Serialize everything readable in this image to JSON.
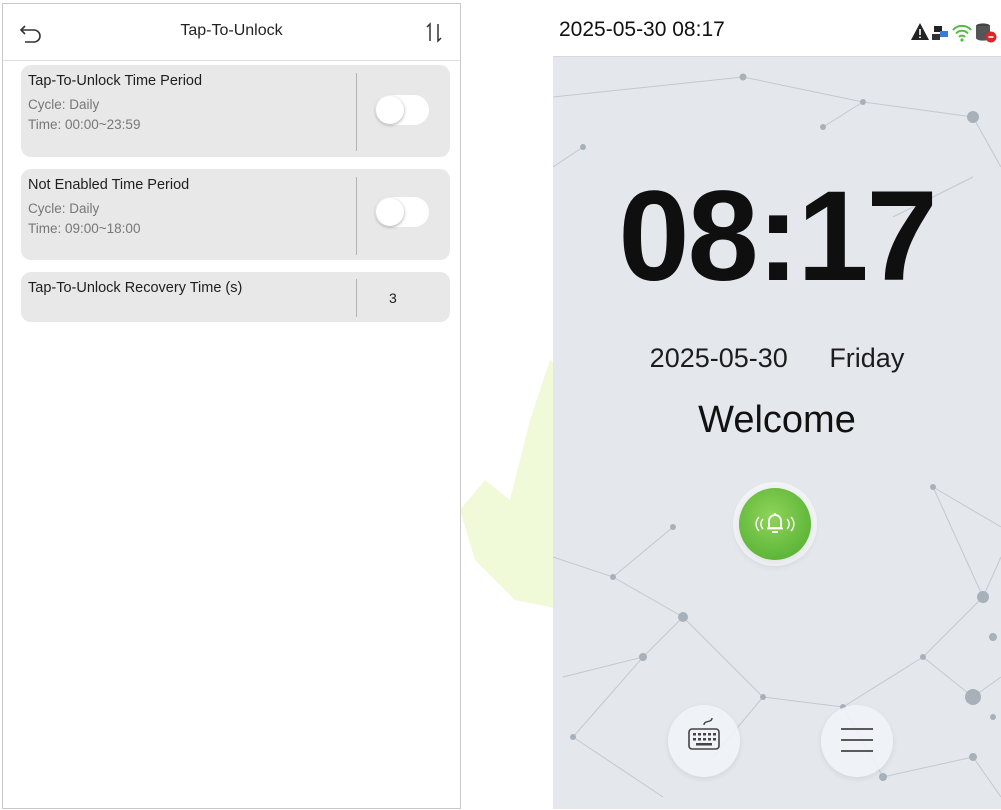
{
  "left": {
    "title": "Tap-To-Unlock",
    "back_icon": "back-arrow-icon",
    "sort_icon": "sort-icon",
    "items": [
      {
        "title": "Tap-To-Unlock Time Period",
        "cycle": "Cycle: Daily",
        "time": "Time: 00:00~23:59",
        "toggle_on": false
      },
      {
        "title": "Not Enabled Time Period",
        "cycle": "Cycle: Daily",
        "time": "Time: 09:00~18:00",
        "toggle_on": false
      },
      {
        "title": "Tap-To-Unlock Recovery Time (s)",
        "value": "3"
      }
    ]
  },
  "right": {
    "status_time": "2025-05-30 08:17",
    "status_icons": [
      "warning-icon",
      "network-icon",
      "wifi-icon",
      "database-icon"
    ],
    "clock": "08:17",
    "date": "2025-05-30",
    "weekday": "Friday",
    "welcome": "Welcome",
    "bell_icon": "doorbell-icon",
    "keyboard_icon": "keyboard-icon",
    "menu_icon": "menu-icon"
  },
  "colors": {
    "card_bg": "#e8e8e8",
    "bell_green": "#6bbf3f",
    "screen_bg": "#e4e8ed",
    "warning": "#d62828"
  }
}
